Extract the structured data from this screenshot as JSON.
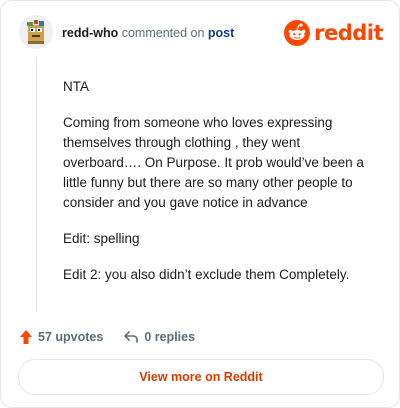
{
  "comment": {
    "username": "redd-who",
    "action_text": "commented on",
    "post_link": "post",
    "paragraphs": [
      "NTA",
      "Coming from someone who loves expressing themselves through clothing , they went overboard…. On Purpose. It prob would’ve been a little funny but there are so many other people to consider and you gave notice in advance",
      "Edit: spelling",
      "Edit 2: you also didn’t exclude them Completely."
    ]
  },
  "brand": {
    "wordmark": "reddit",
    "icon": "reddit-snoo-icon",
    "color": "#ff4500"
  },
  "footer": {
    "upvote_icon": "upvote-arrow-icon",
    "upvotes": "57 upvotes",
    "reply_icon": "reply-arrow-icon",
    "replies": "0 replies"
  },
  "cta": {
    "label": "View more on Reddit",
    "color": "#d93a00"
  }
}
